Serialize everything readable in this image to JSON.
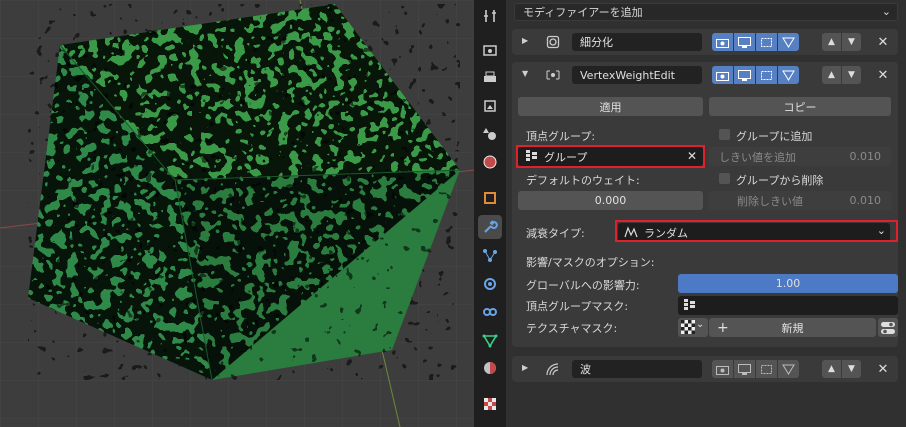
{
  "header": {
    "add_modifier_label": "モディファイアーを追加"
  },
  "modifier_subdiv": {
    "name": "細分化"
  },
  "modifier_vwedit": {
    "name": "VertexWeightEdit",
    "apply_label": "適用",
    "copy_label": "コピー",
    "vertex_group_label": "頂点グループ:",
    "vertex_group_value": "グループ",
    "add_to_group_label": "グループに追加",
    "add_threshold_label": "しきい値を追加",
    "add_threshold_value": "0.010",
    "default_weight_label": "デフォルトのウェイト:",
    "default_weight_value": "0.000",
    "remove_from_group_label": "グループから削除",
    "remove_threshold_label": "削除しきい値",
    "remove_threshold_value": "0.010",
    "falloff_type_label": "減衰タイプ:",
    "falloff_type_value": "ランダム",
    "influence_mask_label": "影響/マスクのオプション:",
    "global_influence_label": "グローバルへの影響力:",
    "global_influence_value": "1.00",
    "global_influence_fraction": 1.0,
    "vertex_group_mask_label": "頂点グループマスク:",
    "texture_mask_label": "テクスチャマスク:",
    "new_label": "新規"
  },
  "modifier_wave": {
    "name": "波"
  },
  "colors": {
    "highlight": "#e0202c",
    "accent": "#5680c2"
  },
  "icons": [
    "tool-icon",
    "render-icon",
    "output-icon",
    "view-layer-icon",
    "scene-icon",
    "world-icon",
    "object-icon",
    "wrench-icon",
    "particles-icon",
    "physics-icon",
    "constraints-icon",
    "data-icon",
    "material-icon",
    "texture-icon"
  ]
}
